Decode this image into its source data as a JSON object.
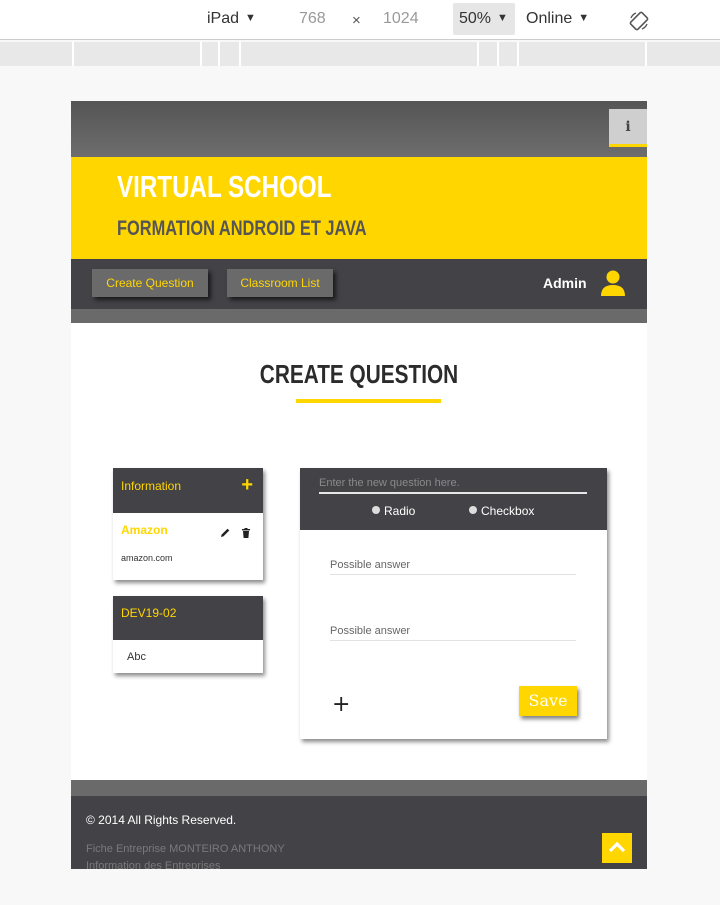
{
  "devtools": {
    "device": "iPad",
    "width": "768",
    "times": "×",
    "height": "1024",
    "zoom": "50%",
    "network": "Online",
    "caret": "▼"
  },
  "topbar": {
    "info_label": "i"
  },
  "header": {
    "brand": "VIRTUAL SCHOOL",
    "subtitle": "FORMATION ANDROID ET JAVA"
  },
  "navbar": {
    "create_question": "Create Question",
    "classroom_list": "Classroom List",
    "user": "Admin"
  },
  "page": {
    "title": "CREATE QUESTION"
  },
  "sidebar": {
    "info_card": {
      "title": "Information",
      "add": "+"
    },
    "amazon_card": {
      "title": "Amazon",
      "url": "amazon.com"
    },
    "class_card": {
      "title": "DEV19-02",
      "item": "Abc"
    }
  },
  "form": {
    "question_placeholder": "Enter the new question here.",
    "options": [
      "Radio",
      "Checkbox"
    ],
    "answer_placeholder_1": "Possible answer",
    "answer_placeholder_2": "Possible answer",
    "add_answer": "+",
    "save": "Save"
  },
  "footer": {
    "copyright": "© 2014 All Rights Reserved.",
    "line1": "Fiche Entreprise MONTEIRO ANTHONY",
    "line2": "Information des Entreprises"
  },
  "colors": {
    "accent": "#ffd600",
    "dark": "#434247",
    "grey": "#6a6a6a"
  }
}
